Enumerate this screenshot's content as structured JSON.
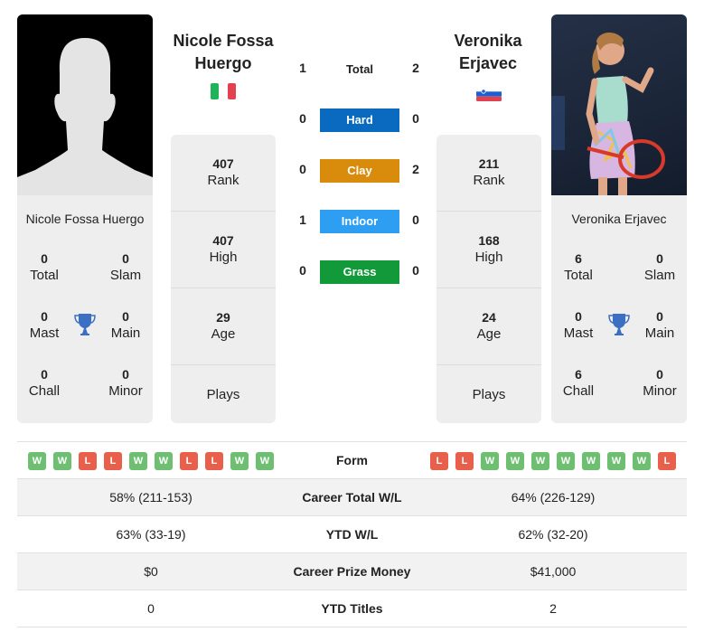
{
  "colors": {
    "hard": "#0a6ac0",
    "clay": "#d98b0b",
    "indoor": "#2d9ef2",
    "grass": "#129a3a",
    "win": "#6fbf73",
    "loss": "#e8604c",
    "trophy": "#3b6fc4"
  },
  "player1": {
    "name_line1": "Nicole Fossa",
    "name_line2": "Huergo",
    "full_name": "Nicole Fossa Huergo",
    "country_flag": "italy-flag",
    "titles": {
      "total": {
        "value": "0",
        "label": "Total"
      },
      "slam": {
        "value": "0",
        "label": "Slam"
      },
      "mast": {
        "value": "0",
        "label": "Mast"
      },
      "main": {
        "value": "0",
        "label": "Main"
      },
      "chall": {
        "value": "0",
        "label": "Chall"
      },
      "minor": {
        "value": "0",
        "label": "Minor"
      }
    },
    "info": {
      "rank": {
        "value": "407",
        "label": "Rank"
      },
      "high": {
        "value": "407",
        "label": "High"
      },
      "age": {
        "value": "29",
        "label": "Age"
      },
      "plays": {
        "value": "",
        "label": "Plays"
      }
    },
    "form": [
      "W",
      "W",
      "L",
      "L",
      "W",
      "W",
      "L",
      "L",
      "W",
      "W"
    ],
    "career_wl": "58% (211-153)",
    "ytd_wl": "63% (33-19)",
    "prize_money": "$0",
    "ytd_titles": "0"
  },
  "player2": {
    "name_line1": "Veronika",
    "name_line2": "Erjavec",
    "full_name": "Veronika Erjavec",
    "country_flag": "slovenia-flag",
    "titles": {
      "total": {
        "value": "6",
        "label": "Total"
      },
      "slam": {
        "value": "0",
        "label": "Slam"
      },
      "mast": {
        "value": "0",
        "label": "Mast"
      },
      "main": {
        "value": "0",
        "label": "Main"
      },
      "chall": {
        "value": "6",
        "label": "Chall"
      },
      "minor": {
        "value": "0",
        "label": "Minor"
      }
    },
    "info": {
      "rank": {
        "value": "211",
        "label": "Rank"
      },
      "high": {
        "value": "168",
        "label": "High"
      },
      "age": {
        "value": "24",
        "label": "Age"
      },
      "plays": {
        "value": "",
        "label": "Plays"
      }
    },
    "form": [
      "L",
      "L",
      "W",
      "W",
      "W",
      "W",
      "W",
      "W",
      "W",
      "L"
    ],
    "career_wl": "64% (226-129)",
    "ytd_wl": "62% (32-20)",
    "prize_money": "$41,000",
    "ytd_titles": "2"
  },
  "h2h": {
    "total": {
      "label": "Total",
      "p1": "1",
      "p2": "2"
    },
    "hard": {
      "label": "Hard",
      "p1": "0",
      "p2": "0"
    },
    "clay": {
      "label": "Clay",
      "p1": "0",
      "p2": "2"
    },
    "indoor": {
      "label": "Indoor",
      "p1": "1",
      "p2": "0"
    },
    "grass": {
      "label": "Grass",
      "p1": "0",
      "p2": "0"
    }
  },
  "table": {
    "form_label": "Form",
    "career_wl_label": "Career Total W/L",
    "ytd_wl_label": "YTD W/L",
    "prize_label": "Career Prize Money",
    "ytd_titles_label": "YTD Titles"
  }
}
